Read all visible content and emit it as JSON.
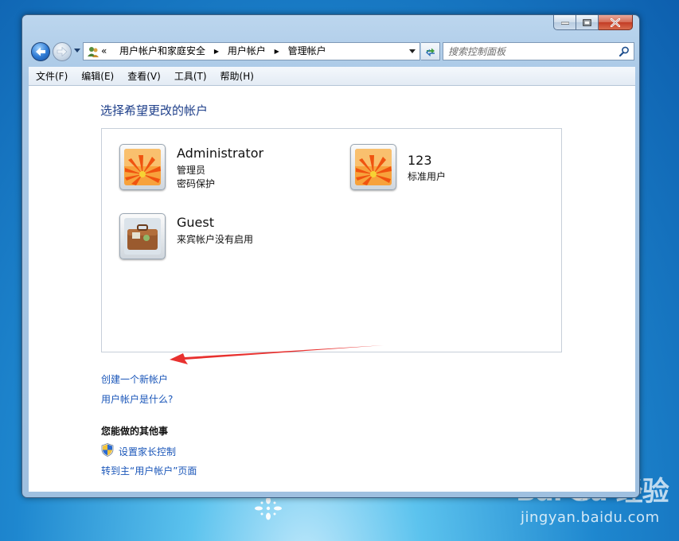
{
  "window": {
    "breadcrumb": [
      "用户帐户和家庭安全",
      "用户帐户",
      "管理帐户"
    ],
    "breadcrumb_prefix": "«",
    "search_placeholder": "搜索控制面板"
  },
  "menubar": {
    "items": [
      "文件(F)",
      "编辑(E)",
      "查看(V)",
      "工具(T)",
      "帮助(H)"
    ]
  },
  "content": {
    "title": "选择希望更改的帐户",
    "accounts": [
      {
        "name": "Administrator",
        "line1": "管理员",
        "line2": "密码保护",
        "picture": "orange-flower"
      },
      {
        "name": "123",
        "line1": "标准用户",
        "line2": "",
        "picture": "orange-flower"
      },
      {
        "name": "Guest",
        "line1": "来宾帐户没有启用",
        "line2": "",
        "picture": "briefcase"
      }
    ],
    "create_link": "创建一个新帐户",
    "what_link": "用户帐户是什么?",
    "other_heading": "您能做的其他事",
    "parental_link": "设置家长控制",
    "goto_link": "转到主“用户帐户”页面"
  },
  "annotation": {
    "color": "#e8312f"
  },
  "watermark": {
    "logo": "Bai du 经验",
    "url": "jingyan.baidu.com"
  },
  "colors": {
    "link": "#1a56b9",
    "title": "#1e3f8a",
    "close_button": "#c33c25"
  }
}
